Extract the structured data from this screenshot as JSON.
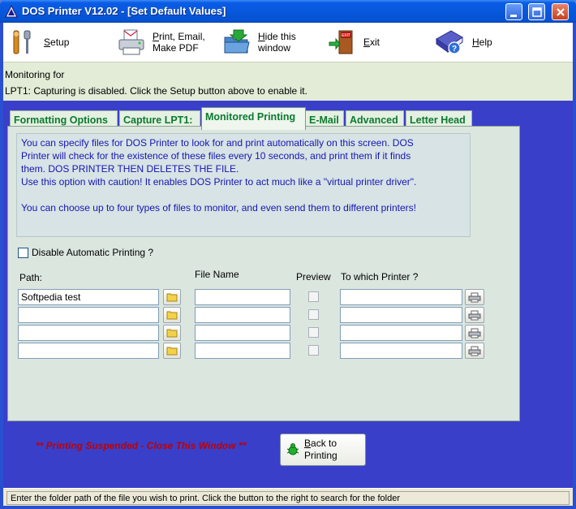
{
  "window": {
    "title": "DOS Printer V12.02 - [Set Default Values]"
  },
  "toolbar": {
    "setup": {
      "key": "S",
      "rest": "etup"
    },
    "print": {
      "key": "P",
      "rest": "rint, Email,\nMake PDF"
    },
    "hide": {
      "key": "H",
      "rest": "ide this\nwindow"
    },
    "exit": {
      "key": "E",
      "rest": "xit"
    },
    "help": {
      "key": "H",
      "rest": "elp"
    }
  },
  "info": {
    "line1": "Monitoring for",
    "line2": "LPT1: Capturing is disabled.  Click the Setup button above to enable it."
  },
  "tabs": [
    {
      "label": "Formatting  Options"
    },
    {
      "label": "Capture LPT1:"
    },
    {
      "label": "Monitored Printing"
    },
    {
      "label": "E-Mail"
    },
    {
      "label": "Advanced"
    },
    {
      "label": "Letter Head"
    }
  ],
  "description": {
    "line1": "You can specify files for DOS Printer to look for and print automatically on this screen.  DOS",
    "line2": "Printer will check for the existence of these files every 10 seconds, and print them if it finds",
    "line3": "them.  DOS PRINTER THEN DELETES THE FILE.",
    "line4": "Use this option with caution!  It enables DOS Printer to act much like a \"virtual printer driver\".",
    "line5": "You can choose up to four types of files to monitor, and even send them to different printers!"
  },
  "disable_auto": {
    "label": "Disable Automatic Printing ?"
  },
  "columns": {
    "path": "Path:",
    "file_name": "File Name",
    "preview": "Preview",
    "printer": "To which Printer ?"
  },
  "rows": [
    {
      "path": "Softpedia test",
      "file": "",
      "printer": ""
    },
    {
      "path": "",
      "file": "",
      "printer": ""
    },
    {
      "path": "",
      "file": "",
      "printer": ""
    },
    {
      "path": "",
      "file": "",
      "printer": ""
    }
  ],
  "bottom": {
    "suspended": "** Printing Suspended - Close This Window **",
    "back": {
      "key": "B",
      "rest": "ack to\nPrinting"
    }
  },
  "statusbar": {
    "text": "Enter the folder path of the file you wish to print.  Click the button to the right to search for the folder"
  }
}
